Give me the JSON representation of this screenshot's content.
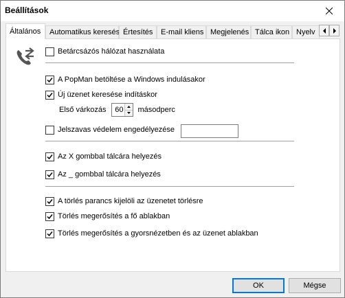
{
  "window": {
    "title": "Beállítások"
  },
  "tabs": [
    {
      "label": "Általános",
      "active": true
    },
    {
      "label": "Automatikus keresés"
    },
    {
      "label": "Értesítés"
    },
    {
      "label": "E-mail kliens"
    },
    {
      "label": "Megjelenés"
    },
    {
      "label": "Tálca ikon"
    },
    {
      "label": "Nyelv"
    }
  ],
  "general": {
    "proxy": {
      "label": "Betárcsázós hálózat használata",
      "checked": false
    },
    "load_on_startup": {
      "label": "A PopMan betöltése a Windows indulásakor",
      "checked": true
    },
    "check_on_start": {
      "label": "Új üzenet keresése indításkor",
      "checked": true
    },
    "first_check": {
      "label": "Első várkozás",
      "value": "60",
      "unit": "másodperc"
    },
    "password_protection": {
      "label": "Jelszavas védelem engedélyezése",
      "checked": false,
      "value": ""
    },
    "x_to_tray": {
      "label": "Az X gombbal tálcára helyezés",
      "checked": true
    },
    "underscore_to_tray": {
      "label": "Az _ gombbal tálcára helyezés",
      "checked": true
    },
    "delete_marks": {
      "label": "A törlés parancs kijelöli az üzenetet törlésre",
      "checked": true
    },
    "confirm_main": {
      "label": "Törlés megerősítés a fő ablakban",
      "checked": true
    },
    "confirm_preview": {
      "label": "Törlés megerősítés a gyorsnézetben és az üzenet ablakban",
      "checked": true
    }
  },
  "buttons": {
    "ok": "OK",
    "cancel": "Mégse"
  },
  "icons": {
    "close": "close-icon",
    "phone": "phone-forward-icon",
    "tab_prev": "chevron-left-icon",
    "tab_next": "chevron-right-icon"
  },
  "colors": {
    "accent": "#0078d7"
  }
}
